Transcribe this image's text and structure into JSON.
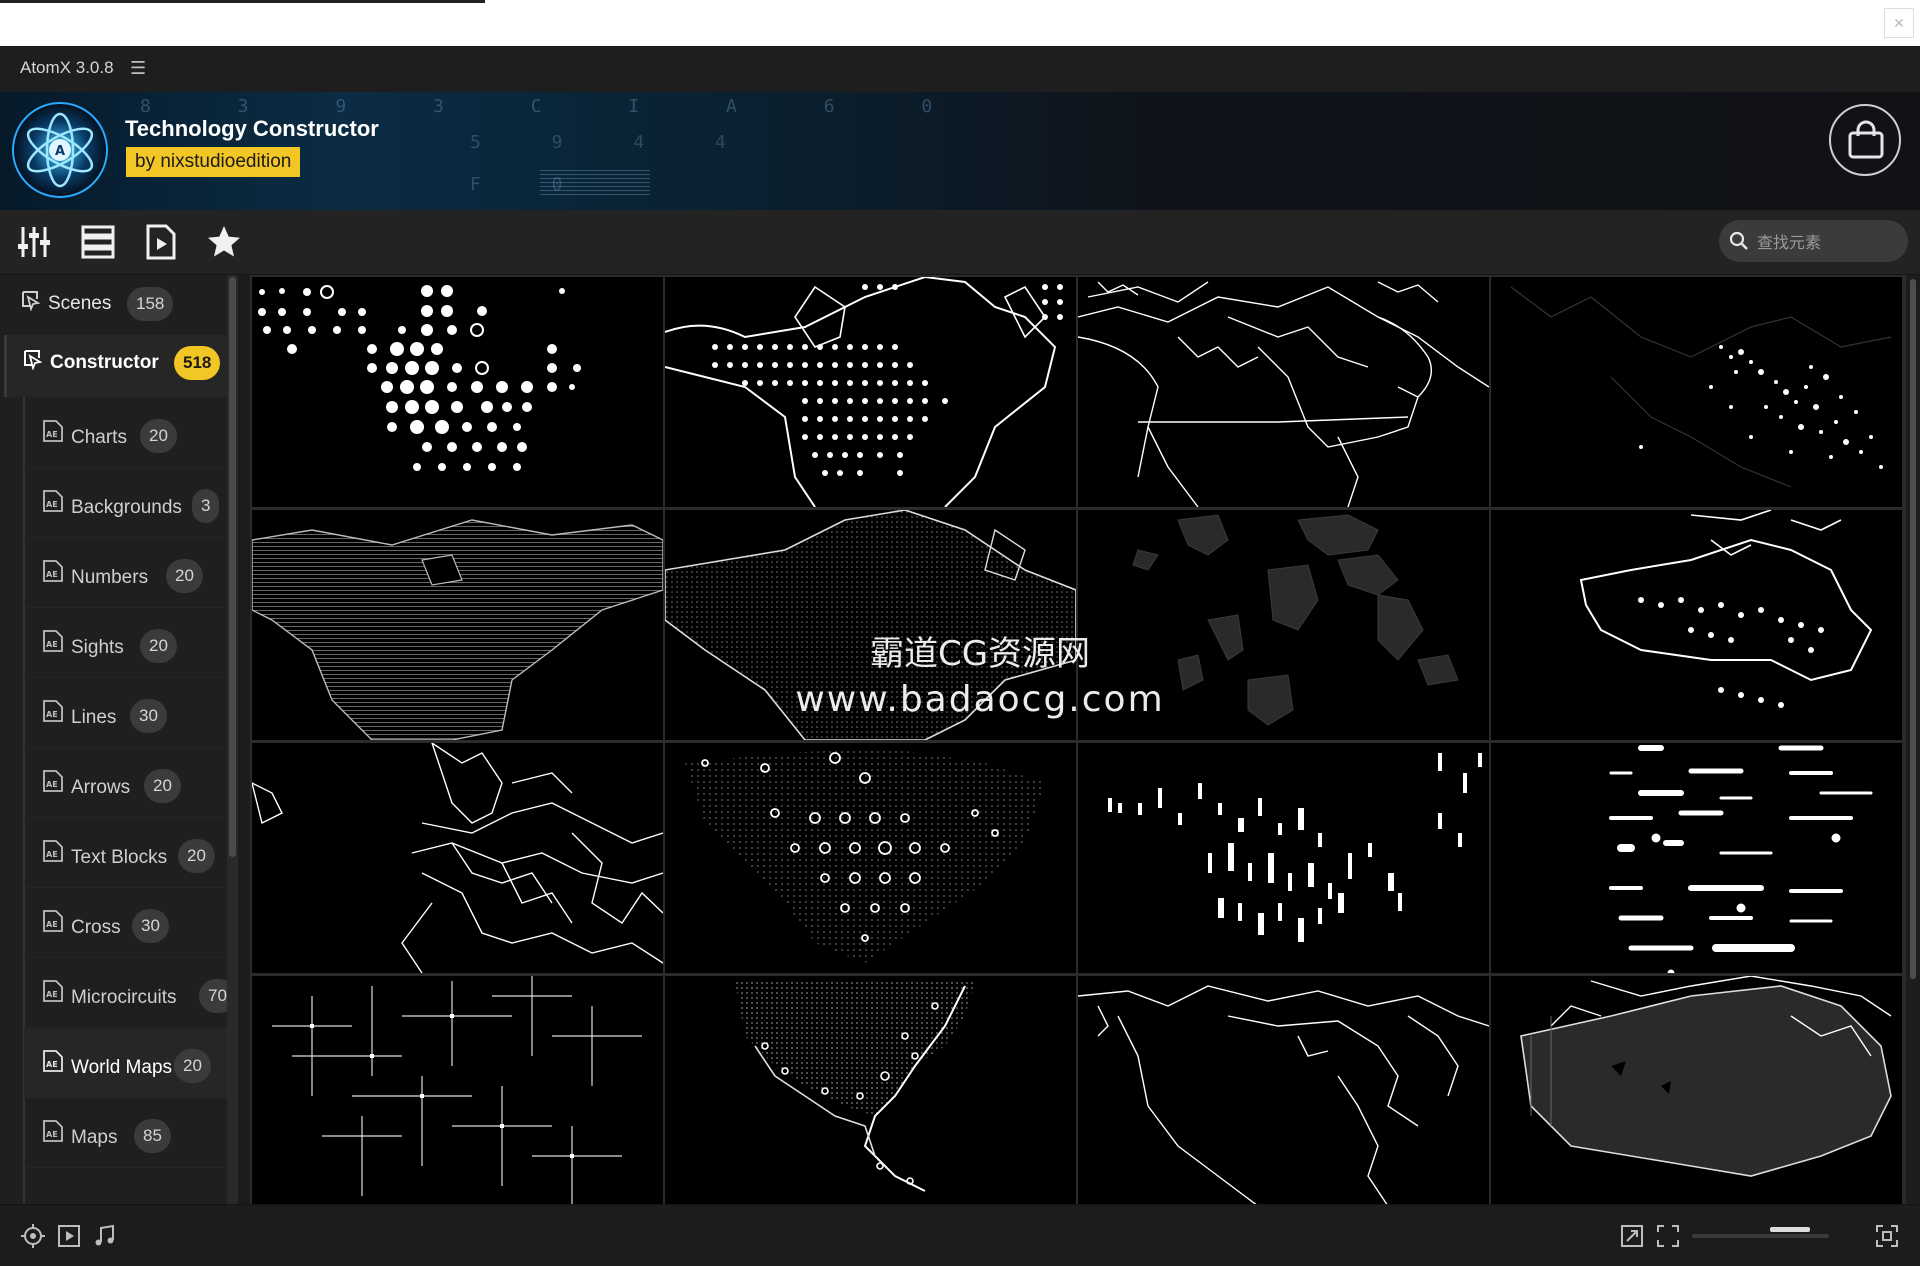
{
  "app": {
    "title": "AtomX 3.0.8"
  },
  "banner": {
    "product_title": "Technology Constructor",
    "author": "by nixstudioedition"
  },
  "search": {
    "placeholder": "查找元素"
  },
  "sidebar": {
    "categories": [
      {
        "label": "Scenes",
        "count": "158"
      },
      {
        "label": "Constructor",
        "count": "518"
      }
    ],
    "subitems": [
      {
        "label": "Charts",
        "count": "20"
      },
      {
        "label": "Backgrounds",
        "count": "3"
      },
      {
        "label": "Numbers",
        "count": "20"
      },
      {
        "label": "Sights",
        "count": "20"
      },
      {
        "label": "Lines",
        "count": "30"
      },
      {
        "label": "Arrows",
        "count": "20"
      },
      {
        "label": "Text Blocks",
        "count": "20"
      },
      {
        "label": "Cross",
        "count": "30"
      },
      {
        "label": "Microcircuits",
        "count": "70"
      },
      {
        "label": "World Maps",
        "count": "20"
      },
      {
        "label": "Maps",
        "count": "85"
      }
    ],
    "selected": "World Maps"
  },
  "watermark": {
    "line1": "霸道CG资源网",
    "line2": "www.badaocg.com"
  },
  "colors": {
    "accent": "#f2c624",
    "panel": "#1f1f1f",
    "tile": "#000000"
  },
  "icons": [
    "close-icon",
    "menu-icon",
    "atom-logo-icon",
    "shopping-bag-icon",
    "sliders-icon",
    "list-icon",
    "video-file-icon",
    "star-icon",
    "search-icon",
    "scene-icon",
    "ae-file-icon",
    "target-icon",
    "play-icon",
    "music-icon",
    "expand-icon",
    "fullscreen-icon",
    "fit-icon"
  ]
}
